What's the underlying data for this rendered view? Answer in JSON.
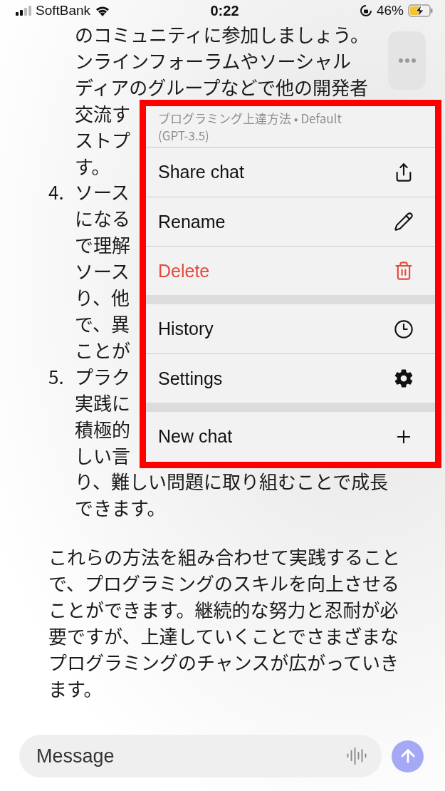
{
  "status_bar": {
    "carrier": "SoftBank",
    "time": "0:22",
    "battery": "46%",
    "charging": true
  },
  "chat": {
    "continuation": [
      "のコミュニティに参加しましょう。",
      "ンラインフォーラムやソーシャル",
      "ディアのグループなどで他の開発者",
      "交流す",
      "ストプ",
      "す。"
    ],
    "list_items": [
      {
        "number": "4.",
        "lines": [
          "ソース",
          "になる",
          "で理解",
          "ソース",
          "り、他",
          "で、異",
          "ことが"
        ]
      },
      {
        "number": "5.",
        "lines": [
          "プラク",
          "実践に",
          "積極的",
          "しい言",
          "り、難しい問題に取り組むことで成長",
          "できます。"
        ]
      }
    ],
    "paragraph": "これらの方法を組み合わせて実践することで、プログラミングのスキルを向上させることができます。継続的な努力と忍耐が必要ですが、上達していくことでさまざまなプログラミングのチャンスが広がっていきます。"
  },
  "menu": {
    "header": "プログラミング上達方法 • Default (GPT-3.5)",
    "highlighted": true,
    "sections": [
      [
        {
          "label": "Share chat",
          "kind": "share",
          "destructive": false
        },
        {
          "label": "Rename",
          "kind": "rename",
          "destructive": false
        },
        {
          "label": "Delete",
          "kind": "delete",
          "destructive": true
        }
      ],
      [
        {
          "label": "History",
          "kind": "history",
          "destructive": false
        },
        {
          "label": "Settings",
          "kind": "settings",
          "destructive": false
        }
      ],
      [
        {
          "label": "New chat",
          "kind": "new",
          "destructive": false
        }
      ]
    ]
  },
  "composer": {
    "placeholder": "Message"
  }
}
